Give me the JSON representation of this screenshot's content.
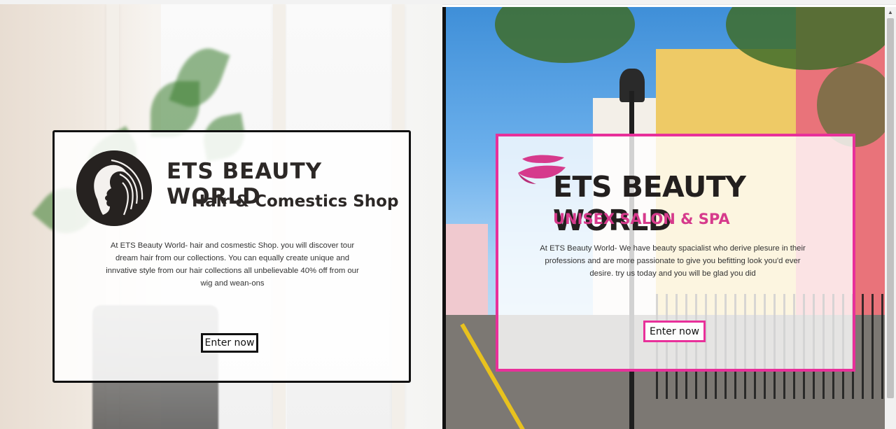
{
  "left_card": {
    "brand": "ETS BEAUTY WORLD",
    "subtitle": "Hair & Comestics Shop",
    "description": "At ETS Beauty World- hair and cosmestic Shop. you will discover tour dream hair from our collections. You can equally create unique and innvative style from our hair collections all unbelievable 40% off from our wig and wean-ons",
    "button_label": "Enter now",
    "border_color": "#111111",
    "logo_icon": "woman-silhouette-logo-icon"
  },
  "right_card": {
    "brand": "ETS BEAUTY WORLD",
    "subtitle": "UNISEX SALON & SPA",
    "description": "At ETS Beauty World- We have beauty spacialist who derive plesure in their professions and are more passionate to give you befitting look you'd ever desire. try us today and you will be glad you did",
    "button_label": "Enter now",
    "accent_color": "#e8309a",
    "logo_icon": "pink-wave-logo-icon"
  }
}
